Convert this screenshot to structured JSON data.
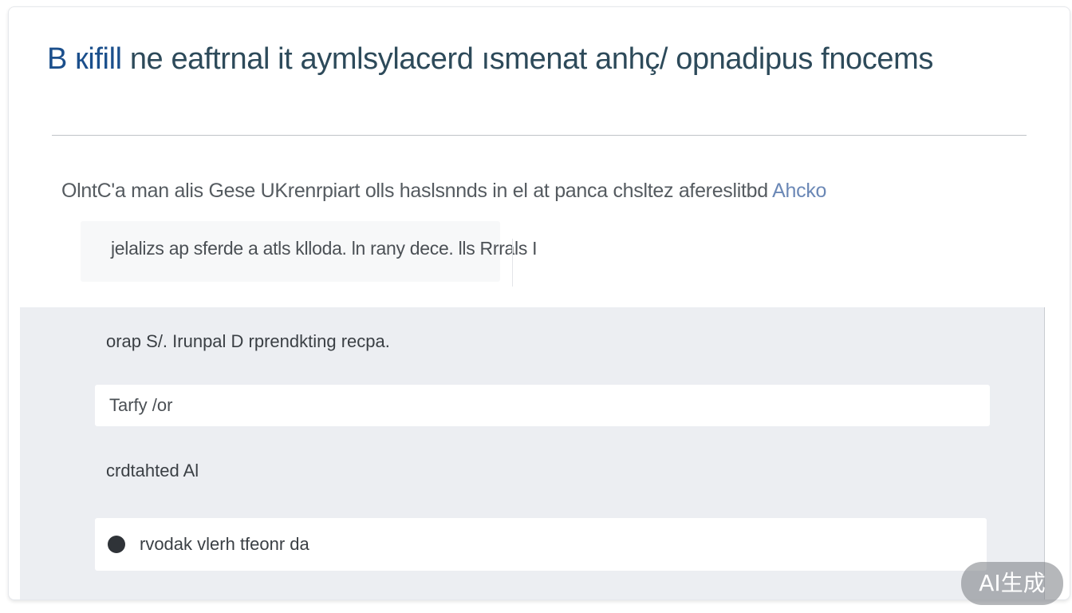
{
  "dialog": {
    "title_lead": "B кifill",
    "title_rest": " ne eaftrnal it aymlsylacerd ısmenat anhç/ opnadipus fnocems",
    "description": "OlntC'a man alis Gese UKrenrpiart olls  haslsnnds in el at panca chsltez  afereslitbd ",
    "description_link": "Ahcko",
    "subtext": "jelalizs ap sferde a atls  klloda. ln rany dece.  lls  Rrrals  I"
  },
  "form": {
    "field1_label": "orap  S/. Irunpal D rprendkting recpa.",
    "field1_value": "Tarfy /or",
    "field2_label": "crdtahted Al",
    "option_label": "rvodak vlerh tfeonr da"
  },
  "watermark": {
    "label": "AI生成"
  }
}
